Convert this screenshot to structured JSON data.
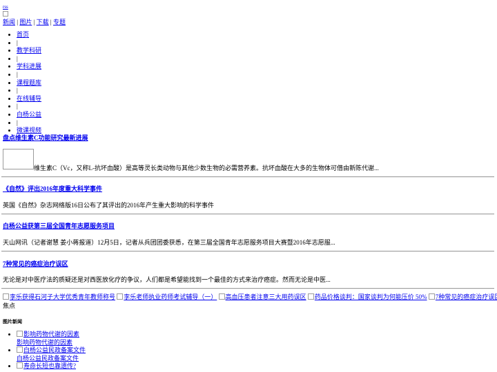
{
  "header": {
    "rss_label": "rss",
    "top_links": [
      "新闻",
      "图片",
      "下载",
      "专题"
    ],
    "separator": "|"
  },
  "nav": {
    "items": [
      "首页",
      "教学科研",
      "学科进展",
      "课程题库",
      "在线辅导",
      "白杨公益",
      "微课视频"
    ],
    "separator": "|"
  },
  "news": [
    {
      "title": "盘点维生素C功能研究最新进展",
      "summary": "维生素C（Vc，又称L-抗坏血酸）是高等灵长类动物与其他少数生物的必需营养素。抗坏血酸在大多的生物体可借由新陈代谢..."
    },
    {
      "title": "《自然》评出2016年度重大科学事件",
      "summary": "英国《自然》杂志网络版16日公布了其评出的2016年产生重大影响的科学事件"
    },
    {
      "title": "白杨公益获第三届全国青年志愿服务项目",
      "summary": "天山网讯（记者谢慧 姜小蒋报道）12月5日，记者从兵团团委获悉，在第三届全国青年志愿服务项目大赛暨2016年志愿服..."
    },
    {
      "title": "7种常见的癌症治疗误区",
      "summary": "无论是对中医疗法的质疑还是对西医放化疗的争议，人们都是希望能找到一个最佳的方式来治疗癌症。然而无论是中医..."
    }
  ],
  "focus": {
    "items": [
      "李乐获得石河子大学优秀青年教师称号",
      "李乐老师执业药师考试辅导（一）",
      "高血压患者注意三大用药误区",
      "药品价格谈判：国家谈判为何能压价 50%",
      "7种常见的癌症治疗误区"
    ],
    "label": "焦点"
  },
  "pic_news": {
    "title": "图片新闻",
    "items": [
      {
        "alt": "影响药物代谢的因素",
        "caption": "影响药物代谢的因素"
      },
      {
        "alt": "白杨公益民政备案文件",
        "caption": "白杨公益民政备案文件"
      },
      {
        "alt": "寿命长短也靠遗传?",
        "caption": ""
      }
    ]
  }
}
